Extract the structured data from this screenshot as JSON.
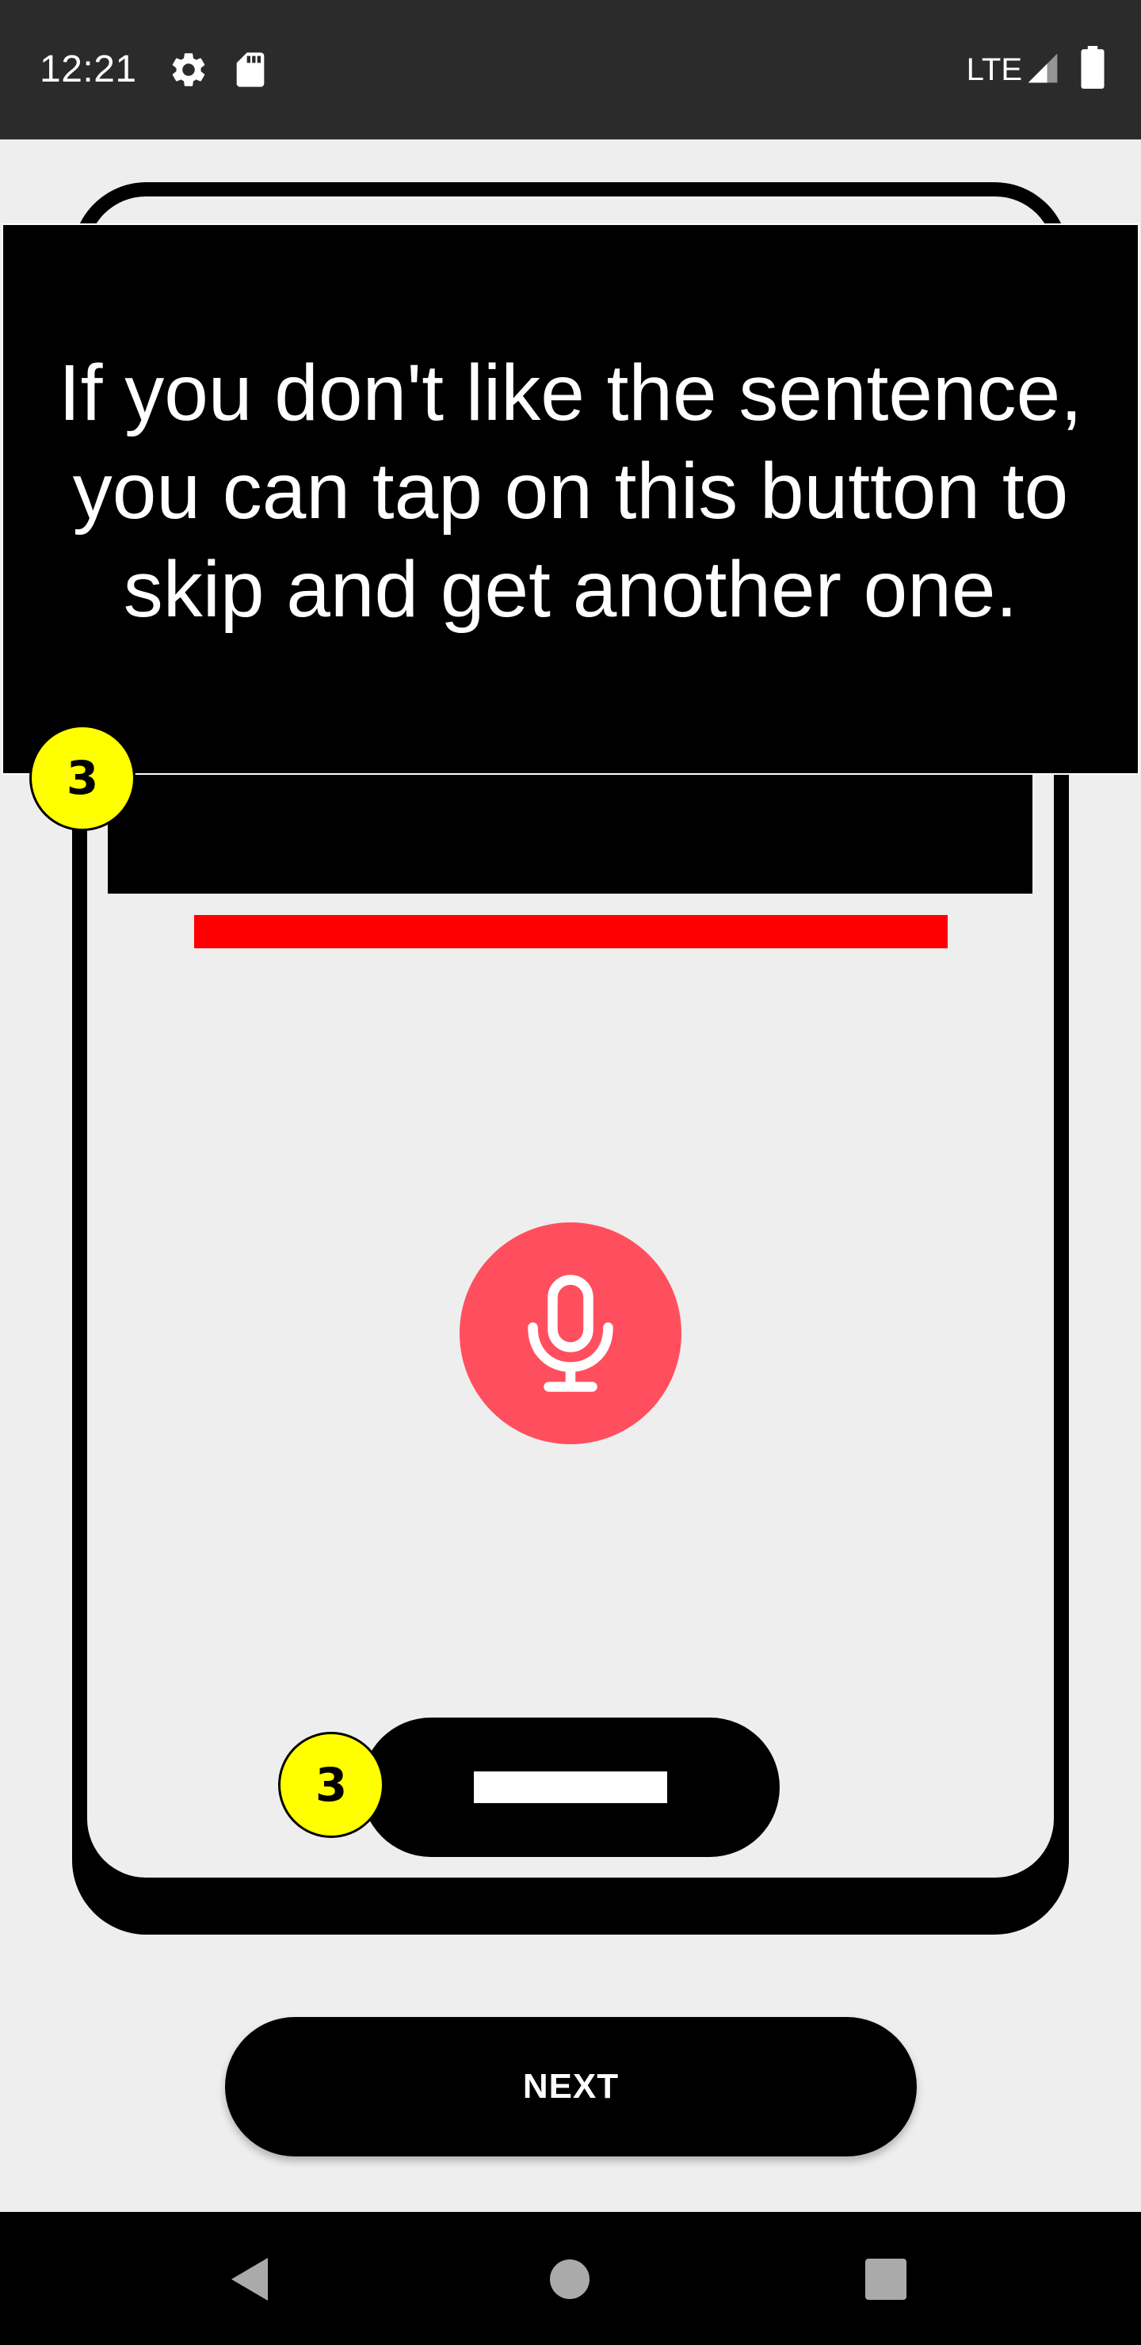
{
  "status_bar": {
    "time": "12:21",
    "network": "LTE",
    "icons": [
      "settings-icon",
      "sd-card-icon",
      "signal-icon",
      "battery-icon"
    ]
  },
  "tooltip": {
    "text": "If you don't like the sentence, you can tap on this button to skip and get another one."
  },
  "badges": {
    "top": "3",
    "bottom": "3"
  },
  "mic_button": {
    "icon": "microphone-icon"
  },
  "next_button": {
    "label": "NEXT"
  },
  "nav_bar": {
    "icons": [
      "back-icon",
      "home-icon",
      "recents-icon"
    ]
  },
  "colors": {
    "status_bar": "#2b2b2b",
    "background": "#eeeeee",
    "mic": "#ff4f5e",
    "progress_bar": "#ff0000",
    "badge": "#ffff00"
  }
}
